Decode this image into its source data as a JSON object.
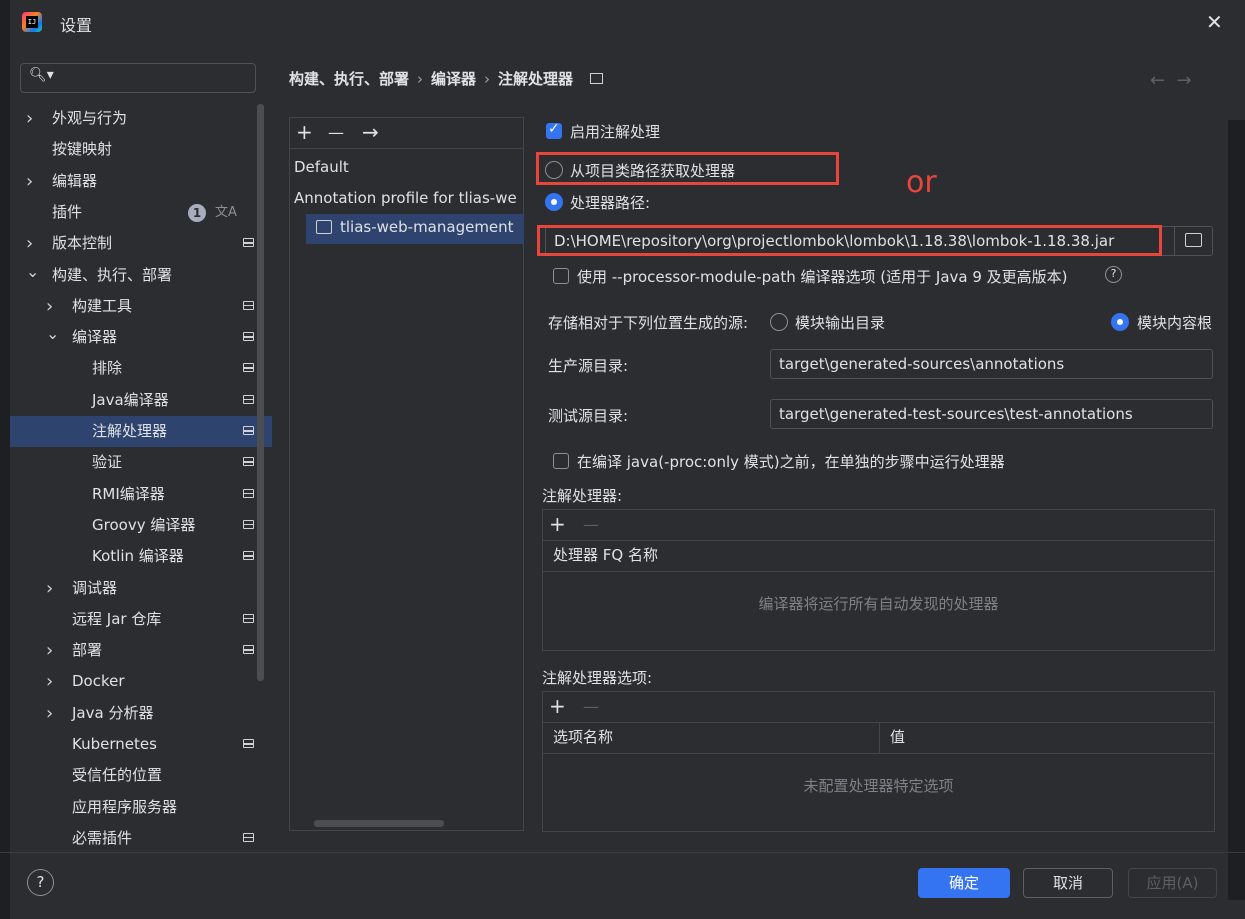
{
  "window": {
    "title": "设置",
    "app_icon": "intellij-idea-icon"
  },
  "search": {
    "placeholder": ""
  },
  "sidebar": {
    "items": [
      {
        "label": "外观与行为",
        "chev": ">",
        "indent": 0
      },
      {
        "label": "按键映射",
        "chev": "",
        "indent": 0
      },
      {
        "label": "编辑器",
        "chev": ">",
        "indent": 0
      },
      {
        "label": "插件",
        "chev": "",
        "indent": 0,
        "badge": "1"
      },
      {
        "label": "版本控制",
        "chev": ">",
        "indent": 0,
        "page": true
      },
      {
        "label": "构建、执行、部署",
        "chev": "v",
        "indent": 0
      },
      {
        "label": "构建工具",
        "chev": ">",
        "indent": 1,
        "page": true
      },
      {
        "label": "编译器",
        "chev": "v",
        "indent": 1,
        "page": true
      },
      {
        "label": "排除",
        "chev": "",
        "indent": 2,
        "page": true
      },
      {
        "label": "Java编译器",
        "chev": "",
        "indent": 2,
        "page": true
      },
      {
        "label": "注解处理器",
        "chev": "",
        "indent": 2,
        "page": true,
        "selected": true
      },
      {
        "label": "验证",
        "chev": "",
        "indent": 2,
        "page": true
      },
      {
        "label": "RMI编译器",
        "chev": "",
        "indent": 2,
        "page": true
      },
      {
        "label": "Groovy 编译器",
        "chev": "",
        "indent": 2,
        "page": true
      },
      {
        "label": "Kotlin 编译器",
        "chev": "",
        "indent": 2,
        "page": true
      },
      {
        "label": "调试器",
        "chev": ">",
        "indent": 1
      },
      {
        "label": "远程 Jar 仓库",
        "chev": "",
        "indent": 1,
        "page": true
      },
      {
        "label": "部署",
        "chev": ">",
        "indent": 1,
        "page": true
      },
      {
        "label": "Docker",
        "chev": ">",
        "indent": 1
      },
      {
        "label": "Java 分析器",
        "chev": ">",
        "indent": 1
      },
      {
        "label": "Kubernetes",
        "chev": "",
        "indent": 1,
        "page": true
      },
      {
        "label": "受信任的位置",
        "chev": "",
        "indent": 1
      },
      {
        "label": "应用程序服务器",
        "chev": "",
        "indent": 1
      },
      {
        "label": "必需插件",
        "chev": "",
        "indent": 1,
        "page": true
      }
    ]
  },
  "breadcrumb": {
    "a": "构建、执行、部署",
    "b": "编译器",
    "c": "注解处理器",
    "sep": "›"
  },
  "profiles": {
    "add": "+",
    "remove": "—",
    "move": "→",
    "items": [
      "Default",
      "Annotation profile for tlias-we",
      "tlias-web-management"
    ]
  },
  "settings": {
    "enable_label": "启用注解处理",
    "from_classpath_label": "从项目类路径获取处理器",
    "processor_path_label": "处理器路径:",
    "processor_path_value": "D:\\HOME\\repository\\org\\projectlombok\\lombok\\1.18.38\\lombok-1.18.38.jar",
    "module_path_label": "使用 --processor-module-path 编译器选项 (适用于 Java 9 及更高版本)",
    "store_label": "存储相对于下列位置生成的源:",
    "module_output_label": "模块输出目录",
    "module_content_label": "模块内容根",
    "prod_dir_label": "生产源目录:",
    "prod_dir_value": "target\\generated-sources\\annotations",
    "test_dir_label": "测试源目录:",
    "test_dir_value": "target\\generated-test-sources\\test-annotations",
    "separate_step_label": "在编译 java(-proc:only 模式)之前，在单独的步骤中运行处理器",
    "processors_label": "注解处理器:",
    "processors_col": "处理器 FQ 名称",
    "processors_empty": "编译器将运行所有自动发现的处理器",
    "options_label": "注解处理器选项:",
    "options_col_name": "选项名称",
    "options_col_value": "值",
    "options_empty": "未配置处理器特定选项"
  },
  "annotation": {
    "or_text": "or",
    "color": "#e8453c"
  },
  "buttons": {
    "ok": "确定",
    "cancel": "取消",
    "apply": "应用(A)",
    "help": "?"
  },
  "colors": {
    "accent": "#3574f0",
    "selection": "#2e436e",
    "background": "#2b2d30"
  }
}
